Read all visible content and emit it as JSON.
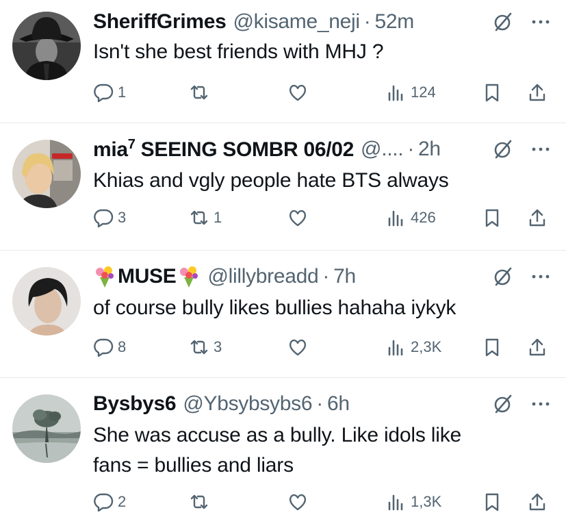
{
  "tweets": [
    {
      "name": "SheriffGrimes",
      "name_sup": "",
      "handle": "@kisame_neji",
      "time": "52m",
      "text": "Isn't she best friends with MHJ ?",
      "replies": "1",
      "reposts": "",
      "views": "124",
      "avatar": "man-in-fedora"
    },
    {
      "name": "mia",
      "name_sup": "7",
      "name_rest": " SEEING SOMBR 06/02",
      "handle": "@....",
      "time": "2h",
      "text": "Khias and vgly people hate BTS always",
      "replies": "3",
      "reposts": "1",
      "views": "426",
      "avatar": "blonde-person"
    },
    {
      "name": "MUSE",
      "name_emoji": "bouquet",
      "handle": "@lillybreadd",
      "time": "7h",
      "text": "of course bully likes bullies hahaha iykyk",
      "replies": "8",
      "reposts": "3",
      "views": "2,3K",
      "avatar": "dark-haired-person"
    },
    {
      "name": "Bysbys6",
      "handle": "@Ybsybsybs6",
      "time": "6h",
      "text_line1": "She was accuse as a bully. Like idols like",
      "text_line2": "fans = bullies and liars",
      "replies": "2",
      "reposts": "",
      "views": "1,3K",
      "avatar": "lake-tree"
    }
  ],
  "separator": "·",
  "colors": {
    "text": "#0f1419",
    "muted": "#536471",
    "divider": "#e6e9ec"
  }
}
